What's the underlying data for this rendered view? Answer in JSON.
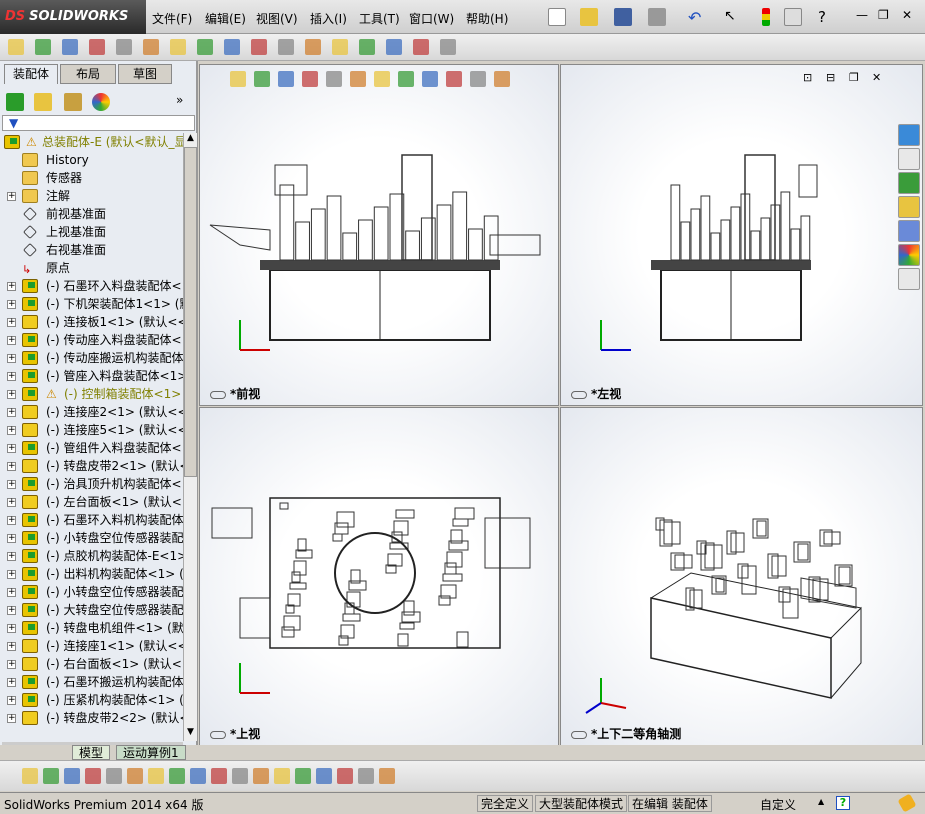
{
  "app": {
    "logo": "SOLIDWORKS",
    "logo_prefix": "DS"
  },
  "menu": [
    "文件(F)",
    "编辑(E)",
    "视图(V)",
    "插入(I)",
    "工具(T)",
    "窗口(W)",
    "帮助(H)"
  ],
  "panel": {
    "tabs": [
      "装配体",
      "布局",
      "草图"
    ],
    "tree": [
      {
        "label": "总装配体-E  (默认<默认_显",
        "type": "root",
        "warn": true
      },
      {
        "label": "History",
        "type": "history"
      },
      {
        "label": "传感器",
        "type": "sensor"
      },
      {
        "label": "注解",
        "type": "annot",
        "plus": true
      },
      {
        "label": "前视基准面",
        "type": "plane"
      },
      {
        "label": "上视基准面",
        "type": "plane"
      },
      {
        "label": "右视基准面",
        "type": "plane"
      },
      {
        "label": "原点",
        "type": "origin"
      },
      {
        "label": "(-) 石墨环入料盘装配体<",
        "type": "asm",
        "plus": true
      },
      {
        "label": "(-) 下机架装配体1<1> (默",
        "type": "asm",
        "plus": true
      },
      {
        "label": "(-) 连接板1<1> (默认<<默",
        "type": "part",
        "plus": true
      },
      {
        "label": "(-) 传动座入料盘装配体<",
        "type": "asm",
        "plus": true
      },
      {
        "label": "(-) 传动座搬运机构装配体",
        "type": "asm",
        "plus": true
      },
      {
        "label": "(-) 管座入料盘装配体<1>",
        "type": "asm",
        "plus": true
      },
      {
        "label": "(-) 控制箱装配体<1>",
        "type": "asm",
        "plus": true,
        "warn": true
      },
      {
        "label": "(-) 连接座2<1> (默认<<默",
        "type": "part",
        "plus": true
      },
      {
        "label": "(-) 连接座5<1> (默认<<默",
        "type": "part",
        "plus": true
      },
      {
        "label": "(-) 管组件入料盘装配体<",
        "type": "asm",
        "plus": true
      },
      {
        "label": "(-) 转盘皮带2<1> (默认<",
        "type": "part",
        "plus": true
      },
      {
        "label": "(-) 治具顶升机构装配体<",
        "type": "asm",
        "plus": true
      },
      {
        "label": "(-) 左台面板<1> (默认<<",
        "type": "part",
        "plus": true
      },
      {
        "label": "(-) 石墨环入料机构装配体",
        "type": "asm",
        "plus": true
      },
      {
        "label": "(-) 小转盘空位传感器装配",
        "type": "asm",
        "plus": true
      },
      {
        "label": "(-) 点胶机构装配体-E<1>",
        "type": "asm",
        "plus": true
      },
      {
        "label": "(-) 出料机构装配体<1> (",
        "type": "asm",
        "plus": true
      },
      {
        "label": "(-) 小转盘空位传感器装配",
        "type": "asm",
        "plus": true
      },
      {
        "label": "(-) 大转盘空位传感器装配",
        "type": "asm",
        "plus": true
      },
      {
        "label": "(-) 转盘电机组件<1> (默",
        "type": "asm",
        "plus": true
      },
      {
        "label": "(-) 连接座1<1> (默认<<默",
        "type": "part",
        "plus": true
      },
      {
        "label": "(-) 右台面板<1> (默认<<",
        "type": "part",
        "plus": true
      },
      {
        "label": "(-) 石墨环搬运机构装配体",
        "type": "asm",
        "plus": true
      },
      {
        "label": "(-) 压紧机构装配体<1> (",
        "type": "asm",
        "plus": true
      },
      {
        "label": "(-) 转盘皮带2<2> (默认<",
        "type": "part",
        "plus": true
      }
    ]
  },
  "views": [
    {
      "label": "*前视"
    },
    {
      "label": "*左视"
    },
    {
      "label": "*上视"
    },
    {
      "label": "*上下二等角轴测"
    }
  ],
  "bottom_tabs": [
    "模型",
    "运动算例1"
  ],
  "status": {
    "product": "SolidWorks Premium 2014 x64 版",
    "fields": [
      "完全定义",
      "大型装配体模式",
      "在编辑 装配体"
    ],
    "units": "自定义"
  },
  "colors": {
    "warning": "#808000",
    "accent": "#1c9c2c"
  }
}
